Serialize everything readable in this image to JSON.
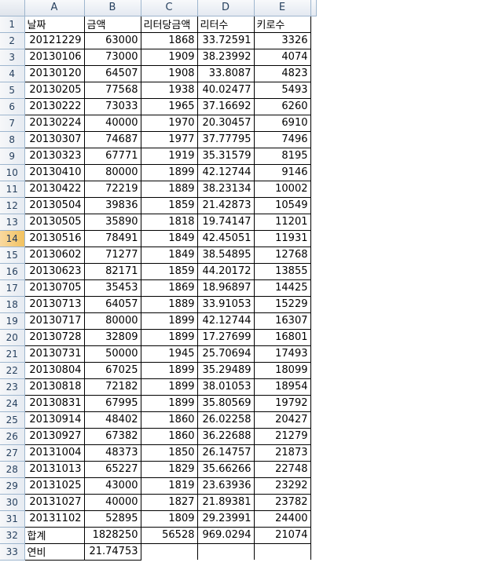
{
  "columns": [
    "A",
    "B",
    "C",
    "D",
    "E"
  ],
  "rows": [
    {
      "n": "1",
      "cells": [
        "날짜",
        "금액",
        "리터당금액",
        "리터수",
        "키로수"
      ]
    },
    {
      "n": "2",
      "cells": [
        "20121229",
        "63000",
        "1868",
        "33.72591",
        "3326"
      ]
    },
    {
      "n": "3",
      "cells": [
        "20130106",
        "73000",
        "1909",
        "38.23992",
        "4074"
      ]
    },
    {
      "n": "4",
      "cells": [
        "20130120",
        "64507",
        "1908",
        "33.8087",
        "4823"
      ]
    },
    {
      "n": "5",
      "cells": [
        "20130205",
        "77568",
        "1938",
        "40.02477",
        "5493"
      ]
    },
    {
      "n": "6",
      "cells": [
        "20130222",
        "73033",
        "1965",
        "37.16692",
        "6260"
      ]
    },
    {
      "n": "7",
      "cells": [
        "20130224",
        "40000",
        "1970",
        "20.30457",
        "6910"
      ]
    },
    {
      "n": "8",
      "cells": [
        "20130307",
        "74687",
        "1977",
        "37.77795",
        "7496"
      ]
    },
    {
      "n": "9",
      "cells": [
        "20130323",
        "67771",
        "1919",
        "35.31579",
        "8195"
      ]
    },
    {
      "n": "10",
      "cells": [
        "20130410",
        "80000",
        "1899",
        "42.12744",
        "9146"
      ]
    },
    {
      "n": "11",
      "cells": [
        "20130422",
        "72219",
        "1889",
        "38.23134",
        "10002"
      ]
    },
    {
      "n": "12",
      "cells": [
        "20130504",
        "39836",
        "1859",
        "21.42873",
        "10549"
      ]
    },
    {
      "n": "13",
      "cells": [
        "20130505",
        "35890",
        "1818",
        "19.74147",
        "11201"
      ]
    },
    {
      "n": "14",
      "cells": [
        "20130516",
        "78491",
        "1849",
        "42.45051",
        "11931"
      ]
    },
    {
      "n": "15",
      "cells": [
        "20130602",
        "71277",
        "1849",
        "38.54895",
        "12768"
      ]
    },
    {
      "n": "16",
      "cells": [
        "20130623",
        "82171",
        "1859",
        "44.20172",
        "13855"
      ]
    },
    {
      "n": "17",
      "cells": [
        "20130705",
        "35453",
        "1869",
        "18.96897",
        "14425"
      ]
    },
    {
      "n": "18",
      "cells": [
        "20130713",
        "64057",
        "1889",
        "33.91053",
        "15229"
      ]
    },
    {
      "n": "19",
      "cells": [
        "20130717",
        "80000",
        "1899",
        "42.12744",
        "16307"
      ]
    },
    {
      "n": "20",
      "cells": [
        "20130728",
        "32809",
        "1899",
        "17.27699",
        "16801"
      ]
    },
    {
      "n": "21",
      "cells": [
        "20130731",
        "50000",
        "1945",
        "25.70694",
        "17493"
      ]
    },
    {
      "n": "22",
      "cells": [
        "20130804",
        "67025",
        "1899",
        "35.29489",
        "18099"
      ]
    },
    {
      "n": "23",
      "cells": [
        "20130818",
        "72182",
        "1899",
        "38.01053",
        "18954"
      ]
    },
    {
      "n": "24",
      "cells": [
        "20130831",
        "67995",
        "1899",
        "35.80569",
        "19792"
      ]
    },
    {
      "n": "25",
      "cells": [
        "20130914",
        "48402",
        "1860",
        "26.02258",
        "20427"
      ]
    },
    {
      "n": "26",
      "cells": [
        "20130927",
        "67382",
        "1860",
        "36.22688",
        "21279"
      ]
    },
    {
      "n": "27",
      "cells": [
        "20131004",
        "48373",
        "1850",
        "26.14757",
        "21873"
      ]
    },
    {
      "n": "28",
      "cells": [
        "20131013",
        "65227",
        "1829",
        "35.66266",
        "22748"
      ]
    },
    {
      "n": "29",
      "cells": [
        "20131025",
        "43000",
        "1819",
        "23.63936",
        "23292"
      ]
    },
    {
      "n": "30",
      "cells": [
        "20131027",
        "40000",
        "1827",
        "21.89381",
        "23782"
      ]
    },
    {
      "n": "31",
      "cells": [
        "20131102",
        "52895",
        "1809",
        "29.23991",
        "24400"
      ]
    },
    {
      "n": "32",
      "cells": [
        "합계",
        "1828250",
        "56528",
        "969.0294",
        "21074"
      ]
    },
    {
      "n": "33",
      "cells": [
        "연비",
        "21.74753",
        "",
        "",
        ""
      ]
    }
  ],
  "active_row": "14"
}
